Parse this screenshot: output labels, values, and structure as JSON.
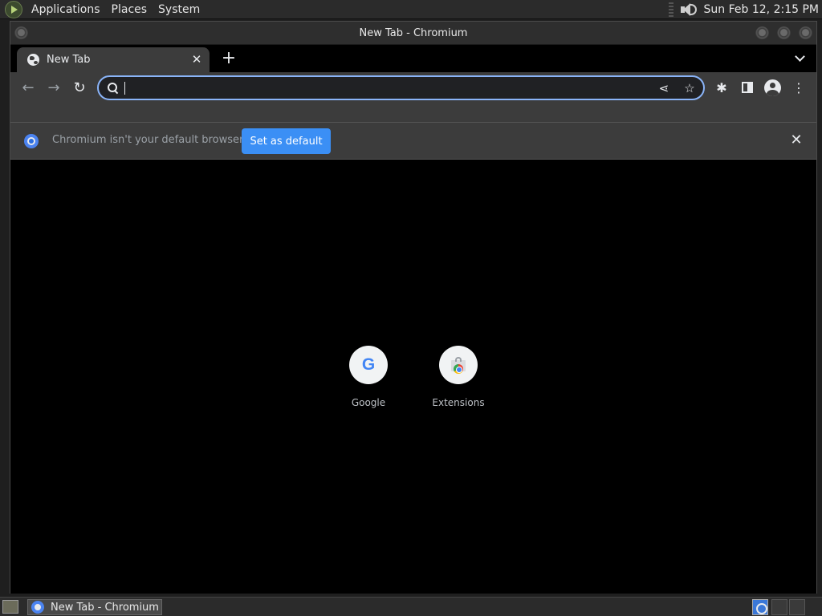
{
  "top_panel": {
    "menus": [
      "Applications",
      "Places",
      "System"
    ],
    "clock": "Sun Feb 12,  2:15 PM"
  },
  "window": {
    "title": "New Tab - Chromium"
  },
  "tabs": [
    {
      "label": "New Tab",
      "active": true
    }
  ],
  "omnibox": {
    "value": "",
    "placeholder": ""
  },
  "infobar": {
    "message": "Chromium isn't your default browser",
    "button_label": "Set as default"
  },
  "shortcuts": [
    {
      "label": "Google",
      "icon": "google-icon"
    },
    {
      "label": "Extensions",
      "icon": "web-store-icon"
    }
  ],
  "taskbar": {
    "tasks": [
      {
        "label": "New Tab - Chromium"
      }
    ]
  },
  "colors": {
    "accent": "#8ab4f8",
    "button": "#3b8ff5",
    "toolbar": "#3c3c3c",
    "page_background": "#000000"
  }
}
